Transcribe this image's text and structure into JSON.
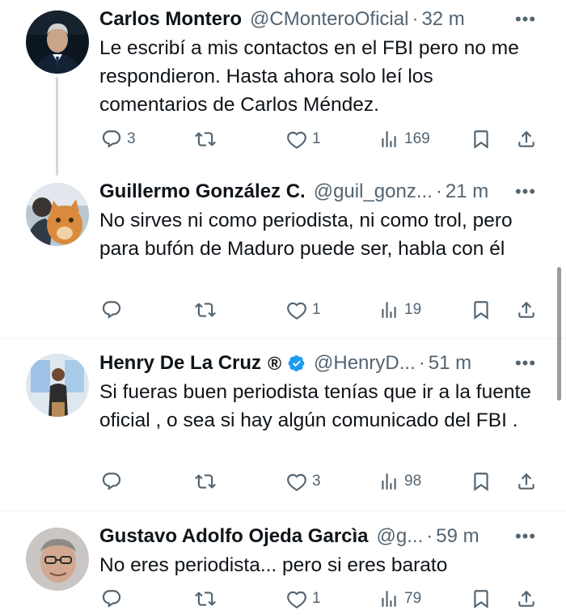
{
  "tweets": [
    {
      "name": "Carlos Montero",
      "handle": "@CMonteroOficial",
      "time": "32 m",
      "text": "Le escribí a mis contactos en el FBI pero no me respondieron. Hasta ahora solo leí los comentarios de Carlos Méndez.",
      "replies": "3",
      "retweets": "",
      "likes": "1",
      "views": "169"
    },
    {
      "name": "Guillermo González C.",
      "handle": "@guil_gonz...",
      "time": "21 m",
      "text": "No sirves ni como periodista, ni como trol, pero para bufón de Maduro puede ser, habla con él",
      "replies": "",
      "retweets": "",
      "likes": "1",
      "views": "19"
    },
    {
      "name": "Henry De La Cruz",
      "registered": "®",
      "handle": "@HenryD...",
      "time": "51 m",
      "text": "Si fueras buen periodista tenías  que ir a la fuente oficial , o sea si hay algún comunicado del FBI .",
      "replies": "",
      "retweets": "",
      "likes": "3",
      "views": "98"
    },
    {
      "name": "Gustavo Adolfo Ojeda Garcìa",
      "handle": "@g...",
      "time": "59 m",
      "text": "No eres periodista... pero si eres barato",
      "replies": "",
      "retweets": "",
      "likes": "1",
      "views": "79"
    }
  ],
  "separator": "·",
  "colors": {
    "text": "#0f1419",
    "secondary": "#536471",
    "verified": "#1d9bf0",
    "divider": "#eff3f4"
  },
  "icons": [
    "reply-icon",
    "retweet-icon",
    "like-icon",
    "views-icon",
    "bookmark-icon",
    "share-icon",
    "more-icon",
    "verified-badge-icon"
  ]
}
